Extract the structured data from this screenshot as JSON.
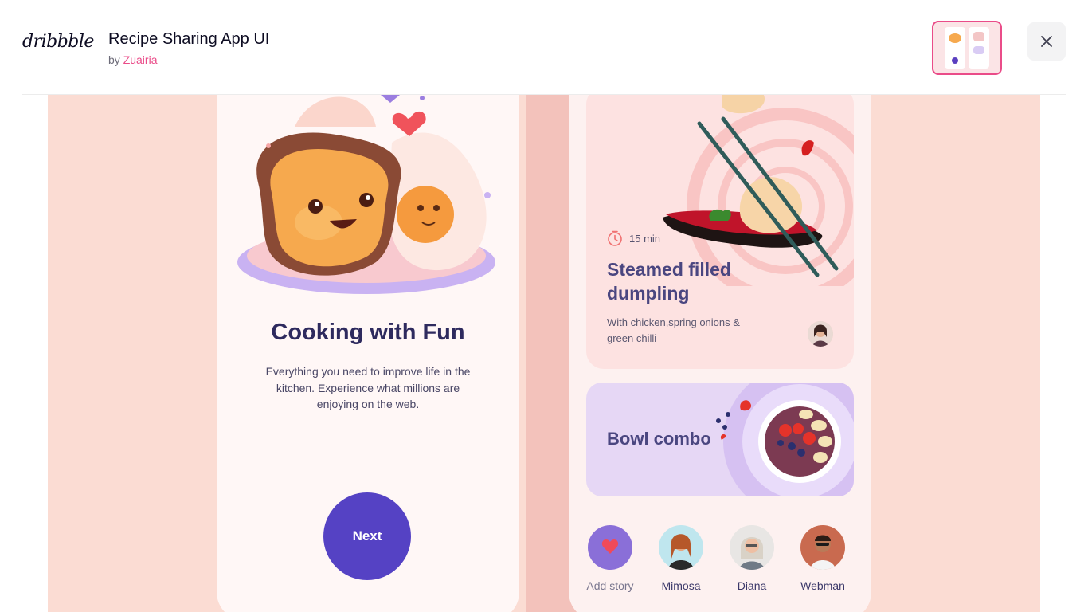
{
  "header": {
    "logo_text": "dribbble",
    "title": "Recipe Sharing App UI",
    "by_prefix": "by",
    "author": "Zuairia"
  },
  "onboarding": {
    "title": "Cooking with Fun",
    "description": "Everything you need to improve life in the kitchen. Experience what millions are enjoying on the web.",
    "next_label": "Next"
  },
  "recipe_card": {
    "time": "15 min",
    "title": "Steamed filled dumpling",
    "description": "With chicken,spring onions & green chilli"
  },
  "bowl_card": {
    "title": "Bowl combo"
  },
  "stories": [
    {
      "name": "Add story"
    },
    {
      "name": "Mimosa"
    },
    {
      "name": "Diana"
    },
    {
      "name": "Webman"
    }
  ],
  "colors": {
    "brand_pink": "#ea4c89",
    "primary_purple": "#5542c4",
    "heading_navy": "#2e2a5e",
    "canvas_peach": "#fbdcd3"
  },
  "icons": [
    "close-icon",
    "clock-icon",
    "heart-icon",
    "chilli-icon"
  ]
}
